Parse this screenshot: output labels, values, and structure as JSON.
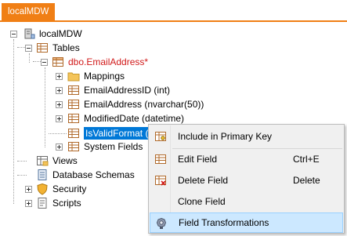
{
  "tab": {
    "label": "localMDW",
    "close": "✕"
  },
  "tree": {
    "root": "localMDW",
    "tables": "Tables",
    "table": "dbo.EmailAddress*",
    "mappings": "Mappings",
    "fields": [
      "EmailAddressID (int)",
      "EmailAddress (nvarchar(50))",
      "ModifiedDate (datetime)",
      "IsValidFormat (bit)"
    ],
    "system_fields": "System Fields",
    "views": "Views",
    "schemas": "Database Schemas",
    "security": "Security",
    "scripts": "Scripts"
  },
  "menu": {
    "items": [
      {
        "label": "Include in Primary Key",
        "shortcut": ""
      },
      {
        "label": "Edit Field",
        "shortcut": "Ctrl+E"
      },
      {
        "label": "Delete Field",
        "shortcut": "Delete"
      },
      {
        "label": "Clone Field",
        "shortcut": ""
      },
      {
        "label": "Field Transformations",
        "shortcut": ""
      }
    ]
  },
  "colors": {
    "accent": "#f07f15",
    "selection": "#0078d7",
    "modified": "#d11a1a",
    "menu_highlight": "#cce8ff"
  }
}
